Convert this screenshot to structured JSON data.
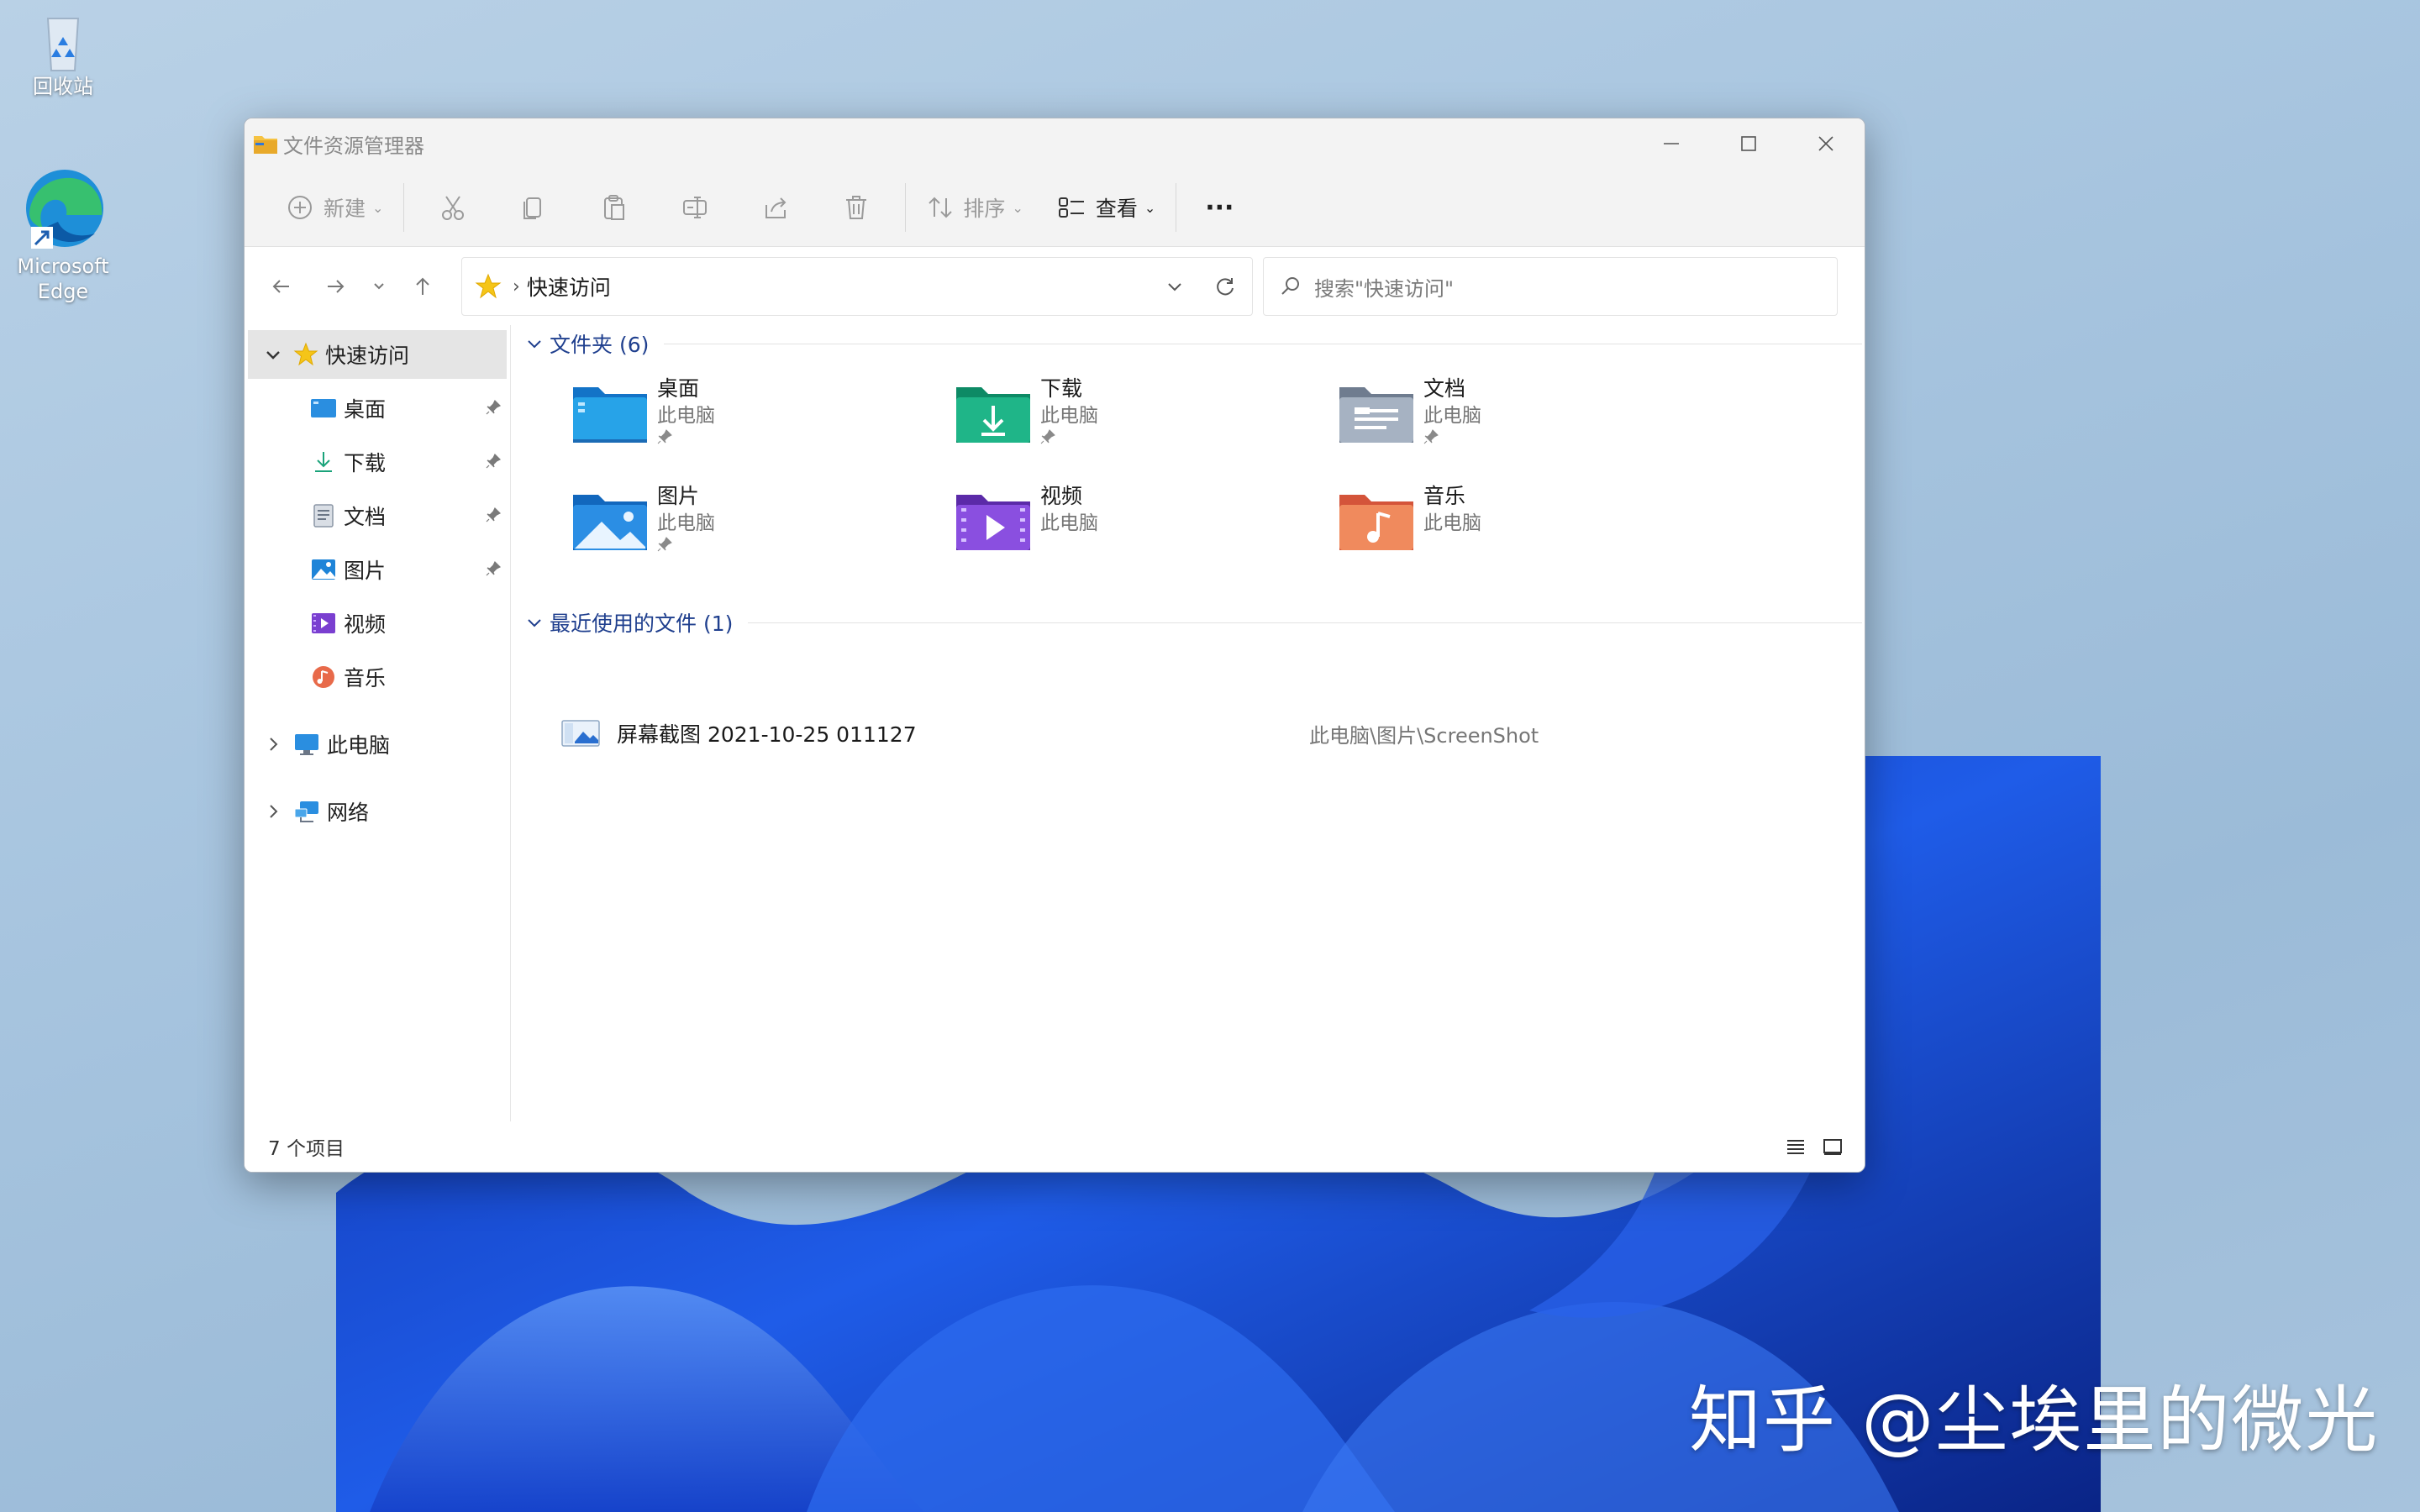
{
  "desktop": {
    "recycle_bin": "回收站",
    "edge": "Microsoft Edge",
    "watermark": "知乎 @尘埃里的微光"
  },
  "window": {
    "title": "文件资源管理器"
  },
  "toolbar": {
    "new_label": "新建",
    "sort_label": "排序",
    "view_label": "查看",
    "more_label": "···"
  },
  "address": {
    "crumb": "快速访问",
    "search_placeholder": "搜索\"快速访问\""
  },
  "sidebar": {
    "quick_access": "快速访问",
    "items": [
      {
        "label": "桌面",
        "pinned": true
      },
      {
        "label": "下载",
        "pinned": true
      },
      {
        "label": "文档",
        "pinned": true
      },
      {
        "label": "图片",
        "pinned": true
      },
      {
        "label": "视频",
        "pinned": false
      },
      {
        "label": "音乐",
        "pinned": false
      }
    ],
    "this_pc": "此电脑",
    "network": "网络"
  },
  "folders_group": {
    "header": "文件夹 (6)",
    "items": [
      {
        "name": "桌面",
        "location": "此电脑",
        "pinned": true,
        "icon": "desktop-folder-icon"
      },
      {
        "name": "下载",
        "location": "此电脑",
        "pinned": true,
        "icon": "downloads-folder-icon"
      },
      {
        "name": "文档",
        "location": "此电脑",
        "pinned": true,
        "icon": "documents-folder-icon"
      },
      {
        "name": "图片",
        "location": "此电脑",
        "pinned": true,
        "icon": "pictures-folder-icon"
      },
      {
        "name": "视频",
        "location": "此电脑",
        "pinned": false,
        "icon": "videos-folder-icon"
      },
      {
        "name": "音乐",
        "location": "此电脑",
        "pinned": false,
        "icon": "music-folder-icon"
      }
    ]
  },
  "recent_group": {
    "header": "最近使用的文件 (1)",
    "files": [
      {
        "name": "屏幕截图 2021-10-25 011127",
        "path": "此电脑\\图片\\ScreenShot"
      }
    ]
  },
  "status": {
    "count": "7 个项目"
  },
  "colors": {
    "accent": "#1f3f8e",
    "desktop_bg": "#a9c6e0",
    "bloom": "#1c4fd6"
  }
}
